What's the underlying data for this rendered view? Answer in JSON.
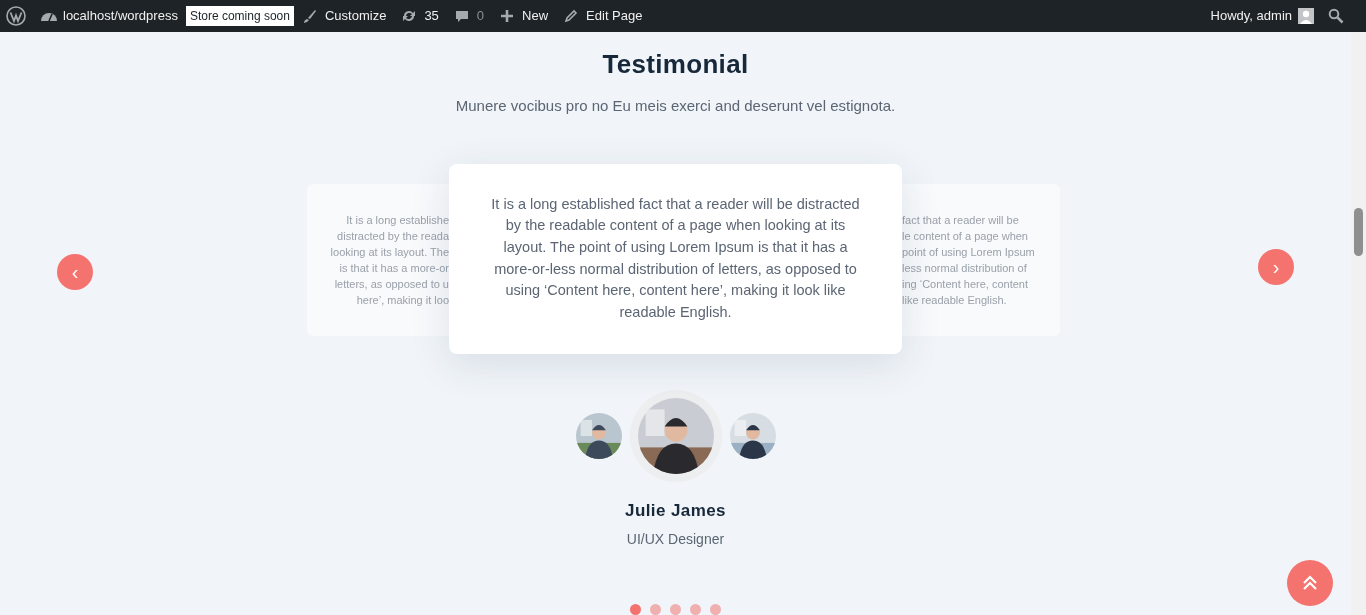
{
  "admin_bar": {
    "site": "localhost/wordpress",
    "badge": "Store coming soon",
    "items": [
      {
        "kind": "customize",
        "label": "Customize"
      },
      {
        "kind": "updates",
        "label": "35"
      },
      {
        "kind": "comments",
        "label": "0"
      },
      {
        "kind": "new",
        "label": "New"
      },
      {
        "kind": "edit",
        "label": "Edit Page"
      }
    ],
    "greeting": "Howdy, admin"
  },
  "section": {
    "title": "Testimonial",
    "subtitle": "Munere vocibus pro no Eu meis exerci and deserunt vel estignota."
  },
  "slides": {
    "previous": [
      "It is a long establishe",
      "distracted by the reada",
      "looking at its layout. The",
      "is that it has a more-or",
      "letters, as opposed to u",
      "here’, making it loo"
    ],
    "current": "It is a long established fact that a reader will be distracted by the readable content of a page when looking at its layout. The point of using Lorem Ipsum is that it has a more-or-less normal distribution of letters, as opposed to using ‘Content here, content here’, making it look like readable English.",
    "next": [
      "fact that a reader will be",
      "le content of a page when",
      "point of using Lorem Ipsum",
      "less normal distribution of",
      "ing ‘Content here, content",
      "like readable English."
    ]
  },
  "prev_button": "‹",
  "next_button": "›",
  "avatars": [
    {
      "kind": "picture",
      "selected": false
    },
    {
      "kind": "picture",
      "selected": true
    },
    {
      "kind": "picture",
      "selected": false
    }
  ],
  "person": {
    "name": "Julie James",
    "role": "UI/UX Designer"
  },
  "dots": [
    {
      "selected": true
    },
    {
      "selected": false
    },
    {
      "selected": false
    },
    {
      "selected": false
    },
    {
      "selected": false
    }
  ]
}
